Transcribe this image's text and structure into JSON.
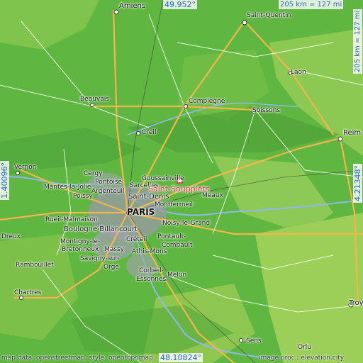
{
  "coordinates": {
    "top_lat": "49.952°",
    "bottom_lat": "48.10824°",
    "left_lon": "1.40096°",
    "right_lon": "4.21348°"
  },
  "scale": {
    "horizontal": "205 km = 127 mi",
    "vertical": "205 km = 127 mi"
  },
  "marker": {
    "name": "Saint-Soupplets"
  },
  "places": {
    "amiens": "Amiens",
    "saint_quentin": "Saint-Quentin",
    "laon": "Laon",
    "beauvais": "Beauvais",
    "compiegne": "Compiègne",
    "soissons": "Soissons",
    "creil": "Creil",
    "reims": "Reim",
    "vernon": "Vernon",
    "cergy": "Cergy",
    "pontoise": "Pontoise",
    "goussainville": "Goussainville",
    "mantes": "Mantes-la-Jolie",
    "argenteuil": "Argenteuil",
    "sarcelles": "Sarcelles",
    "poissy": "Poissy",
    "saint_denis": "Saint-Denis",
    "meaux": "Meaux",
    "montfermeil": "Montfermeil",
    "paris": "PARIS",
    "rueil": "Rueil-Malmaison",
    "boulogne": "Boulogne-Billancourt",
    "noisy": "Noisy-le-Grand",
    "dreux": "Dreux",
    "montigny": "Montigny-le-",
    "bretonneux": "Bretonneux",
    "massy": "Massy",
    "creteil": "Créteil",
    "pontault": "Pontault-",
    "combault": "Combault",
    "athis": "Athis-Mons",
    "rambouillet": "Rambouillet",
    "savigny": "Savigny-sur-",
    "orge": "Orge",
    "corbeil": "Corbeil-",
    "essonnes": "Essonnes",
    "melun": "Melun",
    "chartres": "Chartres",
    "sens": "Sens",
    "troyes": "Troy",
    "orlu": "Orlu"
  },
  "credits": {
    "left": "map data: openstreetmap, style: opentopomap",
    "right": "image proc.: elevation.city"
  },
  "colors": {
    "terrain_base": "#5fb640",
    "highland": "#9ccf57",
    "urban": "#9a9aa8",
    "road_major": "#f2b64a",
    "road_minor": "#ffffff",
    "water": "#8fb8f0",
    "marker": "#e0304a",
    "coordinate_text": "#2b64c8"
  }
}
